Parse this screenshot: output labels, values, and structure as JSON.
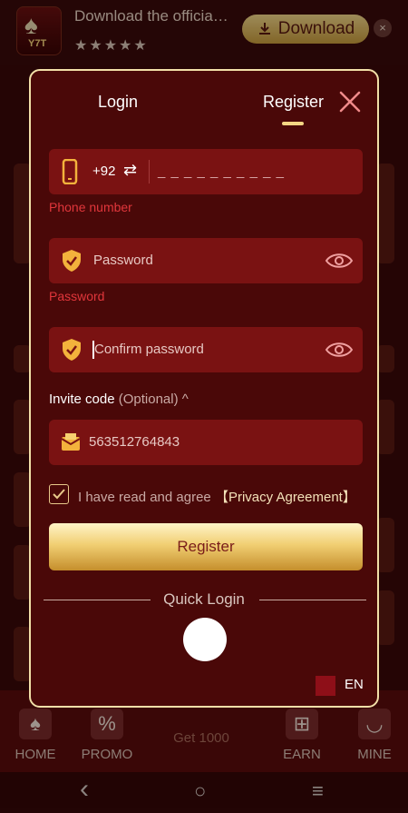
{
  "banner": {
    "logo_text": "Y7T",
    "title": "Download the officia…",
    "stars": "★★★★★",
    "download_label": "Download",
    "close_glyph": "×"
  },
  "modal": {
    "tabs": {
      "login": "Login",
      "register": "Register",
      "active": "register"
    },
    "phone": {
      "country_code": "+92",
      "swap_glyph": "⇄",
      "placeholder": "_ _ _ _ _ _ _ _ _ _",
      "error": "Phone number"
    },
    "password": {
      "placeholder": "Password",
      "error": "Password"
    },
    "confirm_password": {
      "placeholder": "Confirm password"
    },
    "invite": {
      "label": "Invite code",
      "optional": "(Optional)",
      "chevron": "^",
      "value": "563512764843"
    },
    "agree": {
      "text": "I have read and agree",
      "link": "【Privacy Agreement】",
      "checked": true
    },
    "register_button": "Register",
    "quick_login": "Quick Login",
    "language": "EN"
  },
  "bottom_nav": {
    "items": [
      {
        "label": "HOME"
      },
      {
        "label": "PROMO"
      },
      {
        "label": "Get 1000"
      },
      {
        "label": "EARN"
      },
      {
        "label": "MINE"
      }
    ]
  },
  "system_nav": {
    "back": "‹",
    "home": "○",
    "menu": "≡"
  },
  "colors": {
    "accent_gold": "#f4d584",
    "field_bg": "#7a1212",
    "modal_bg": "#4a0808",
    "error": "#e1363b"
  }
}
